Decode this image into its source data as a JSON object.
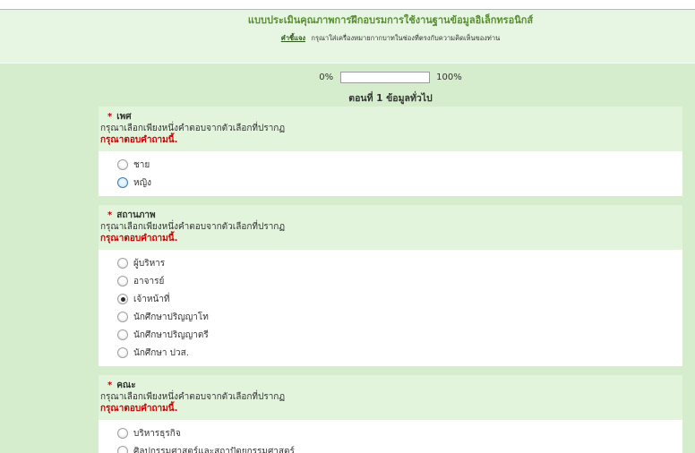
{
  "colors": {
    "page_bg": "#d5edcc",
    "header_bg": "#e7f6e2",
    "question_header_bg": "#e3f4dd",
    "title": "#5a8e33",
    "required": "#cc0000",
    "error": "#cc0000"
  },
  "survey": {
    "title": "แบบประเมินคุณภาพการฝึกอบรมการใช้งานฐานข้อมูลอิเล็กทรอนิกส์",
    "instructions_label": "คำชี้แจง",
    "instructions_text": "กรุณาใส่เครื่องหมายกากบาทในช่องที่ตรงกับความคิดเห็นของท่าน"
  },
  "progress": {
    "start_label": "0%",
    "end_label": "100%",
    "percent": 0
  },
  "section": {
    "title": "ตอนที่ 1 ข้อมูลทั่วไป"
  },
  "questions": [
    {
      "required_mark": "*",
      "title": "เพศ",
      "help": "กรุณาเลือกเพียงหนึ่งคำตอบจากตัวเลือกที่ปรากฏ",
      "error": "กรุณาตอบคำถามนี้.",
      "options": [
        {
          "label": "ชาย",
          "selected": false,
          "focused": false
        },
        {
          "label": "หญิง",
          "selected": false,
          "focused": true
        }
      ]
    },
    {
      "required_mark": "*",
      "title": "สถานภาพ",
      "help": "กรุณาเลือกเพียงหนึ่งคำตอบจากตัวเลือกที่ปรากฏ",
      "error": "กรุณาตอบคำถามนี้.",
      "options": [
        {
          "label": "ผู้บริหาร",
          "selected": false,
          "focused": false
        },
        {
          "label": "อาจารย์",
          "selected": false,
          "focused": false
        },
        {
          "label": "เจ้าหน้าที่",
          "selected": true,
          "focused": false
        },
        {
          "label": "นักศึกษาปริญญาโท",
          "selected": false,
          "focused": false
        },
        {
          "label": "นักศึกษาปริญญาตรี",
          "selected": false,
          "focused": false
        },
        {
          "label": "นักศึกษา ปวส.",
          "selected": false,
          "focused": false
        }
      ]
    },
    {
      "required_mark": "*",
      "title": "คณะ",
      "help": "กรุณาเลือกเพียงหนึ่งคำตอบจากตัวเลือกที่ปรากฏ",
      "error": "กรุณาตอบคำถามนี้.",
      "options": [
        {
          "label": "บริหารธุรกิจ",
          "selected": false,
          "focused": false
        },
        {
          "label": "ศิลปกรรมศาสตร์และสถาปัตยกรรมศาสตร์",
          "selected": false,
          "focused": false
        }
      ]
    }
  ]
}
